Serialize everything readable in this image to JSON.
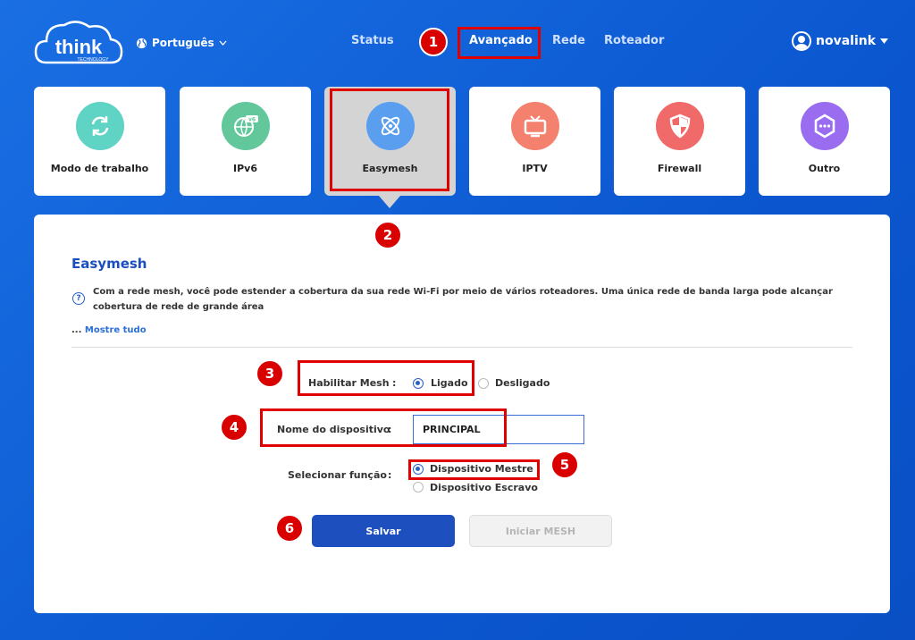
{
  "header": {
    "logo_text": "think",
    "logo_sub": "TECHNOLOGY",
    "language": "Português",
    "nav": [
      "Status",
      "Avançado",
      "Rede",
      "Roteador"
    ],
    "user": "novalink"
  },
  "cards": [
    {
      "label": "Modo de trabalho",
      "icon": "sync-icon",
      "color": "#5fd3c4"
    },
    {
      "label": "IPv6",
      "icon": "ipv6-globe-icon",
      "color": "#62c79a"
    },
    {
      "label": "Easymesh",
      "icon": "atom-icon",
      "color": "#5a9ef0"
    },
    {
      "label": "IPTV",
      "icon": "tv-icon",
      "color": "#f4806e"
    },
    {
      "label": "Firewall",
      "icon": "shield-icon",
      "color": "#f06a6a"
    },
    {
      "label": "Outro",
      "icon": "more-icon",
      "color": "#9a6df0"
    }
  ],
  "callouts": [
    "1",
    "2",
    "3",
    "4",
    "5",
    "6"
  ],
  "panel": {
    "title": "Easymesh",
    "description": "Com a rede mesh, você pode estender a cobertura da sua rede Wi-Fi por meio de vários roteadores. Uma única rede de banda larga pode alcançar cobertura de rede de grande área",
    "more_prefix": "...",
    "more_link": "Mostre tudo",
    "mesh_label": "Habilitar Mesh",
    "mesh_on": "Ligado",
    "mesh_off": "Desligado",
    "device_label": "Nome do dispositivo",
    "device_value": "PRINCIPAL",
    "role_label": "Selecionar função",
    "role_master": "Dispositivo Mestre",
    "role_slave": "Dispositivo Escravo",
    "colon": ":",
    "save": "Salvar",
    "start_mesh": "Iniciar MESH"
  },
  "colors": {
    "accent": "#1d4fbf",
    "callout": "#d90000",
    "background": "#0b57d0"
  }
}
